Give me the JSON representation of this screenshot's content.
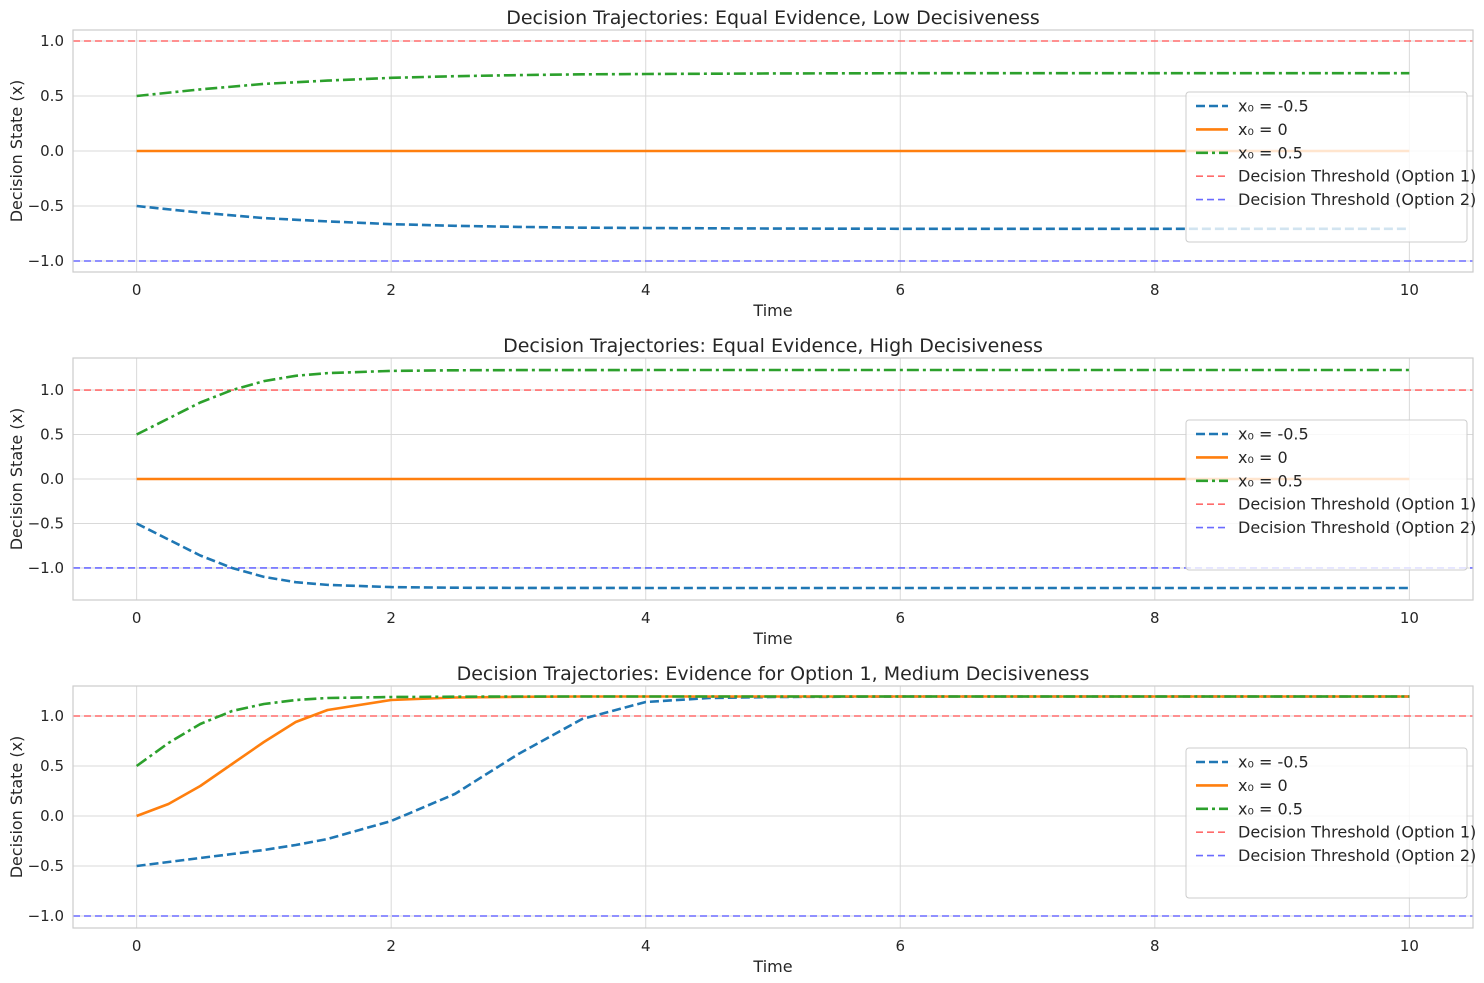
{
  "colors": {
    "series": [
      "#1f77b4",
      "#ff7f0e",
      "#2ca02c"
    ],
    "threshold_option1": "#ff6b6b",
    "threshold_option2": "#6b6bff",
    "grid": "#d9d9d9"
  },
  "chart_data": [
    {
      "type": "line",
      "title": "Decision Trajectories: Equal Evidence, Low Decisiveness",
      "xlabel": "Time",
      "ylabel": "Decision State (x)",
      "xlim": [
        -0.5,
        10.5
      ],
      "ylim": [
        -1.1,
        1.1
      ],
      "xticks": [
        0,
        2,
        4,
        6,
        8,
        10
      ],
      "yticks": [
        -1.0,
        -0.5,
        0.0,
        0.5,
        1.0
      ],
      "grid": true,
      "legend_position": "center-right",
      "x": [
        0,
        0.5,
        1,
        1.5,
        2,
        2.5,
        3,
        3.5,
        4,
        5,
        6,
        7,
        8,
        9,
        10
      ],
      "series": [
        {
          "name": "x₀ = -0.5",
          "style": "dashed",
          "values": [
            -0.5,
            -0.56,
            -0.61,
            -0.64,
            -0.665,
            -0.68,
            -0.69,
            -0.697,
            -0.7,
            -0.705,
            -0.707,
            -0.707,
            -0.707,
            -0.707,
            -0.707
          ]
        },
        {
          "name": "x₀ = 0",
          "style": "solid",
          "values": [
            0,
            0,
            0,
            0,
            0,
            0,
            0,
            0,
            0,
            0,
            0,
            0,
            0,
            0,
            0
          ]
        },
        {
          "name": "x₀ = 0.5",
          "style": "dashdot",
          "values": [
            0.5,
            0.56,
            0.61,
            0.64,
            0.665,
            0.68,
            0.69,
            0.697,
            0.7,
            0.705,
            0.707,
            0.707,
            0.707,
            0.707,
            0.707
          ]
        }
      ],
      "thresholds": [
        {
          "name": "Decision Threshold (Option 1)",
          "value": 1.0
        },
        {
          "name": "Decision Threshold (Option 2)",
          "value": -1.0
        }
      ]
    },
    {
      "type": "line",
      "title": "Decision Trajectories: Equal Evidence, High Decisiveness",
      "xlabel": "Time",
      "ylabel": "Decision State (x)",
      "xlim": [
        -0.5,
        10.5
      ],
      "ylim": [
        -1.36,
        1.36
      ],
      "xticks": [
        0,
        2,
        4,
        6,
        8,
        10
      ],
      "yticks": [
        -1.0,
        -0.5,
        0.0,
        0.5,
        1.0
      ],
      "grid": true,
      "legend_position": "center-right",
      "x": [
        0,
        0.25,
        0.5,
        0.75,
        1,
        1.25,
        1.5,
        2,
        2.5,
        3,
        4,
        5,
        6,
        7,
        8,
        9,
        10
      ],
      "series": [
        {
          "name": "x₀ = -0.5",
          "style": "dashed",
          "values": [
            -0.5,
            -0.68,
            -0.86,
            -1.0,
            -1.1,
            -1.16,
            -1.19,
            -1.215,
            -1.222,
            -1.224,
            -1.225,
            -1.225,
            -1.225,
            -1.225,
            -1.225,
            -1.225,
            -1.225
          ]
        },
        {
          "name": "x₀ = 0",
          "style": "solid",
          "values": [
            0,
            0,
            0,
            0,
            0,
            0,
            0,
            0,
            0,
            0,
            0,
            0,
            0,
            0,
            0,
            0,
            0
          ]
        },
        {
          "name": "x₀ = 0.5",
          "style": "dashdot",
          "values": [
            0.5,
            0.68,
            0.86,
            1.0,
            1.1,
            1.16,
            1.19,
            1.215,
            1.222,
            1.224,
            1.225,
            1.225,
            1.225,
            1.225,
            1.225,
            1.225,
            1.225
          ]
        }
      ],
      "thresholds": [
        {
          "name": "Decision Threshold (Option 1)",
          "value": 1.0
        },
        {
          "name": "Decision Threshold (Option 2)",
          "value": -1.0
        }
      ]
    },
    {
      "type": "line",
      "title": "Decision Trajectories: Evidence for Option 1, Medium Decisiveness",
      "xlabel": "Time",
      "ylabel": "Decision State (x)",
      "xlim": [
        -0.5,
        10.5
      ],
      "ylim": [
        -1.12,
        1.3
      ],
      "xticks": [
        0,
        2,
        4,
        6,
        8,
        10
      ],
      "yticks": [
        -1.0,
        -0.5,
        0.0,
        0.5,
        1.0
      ],
      "grid": true,
      "legend_position": "center-right",
      "x": [
        0,
        0.25,
        0.5,
        0.75,
        1,
        1.25,
        1.5,
        2,
        2.5,
        3,
        3.5,
        4,
        4.5,
        5,
        6,
        7,
        8,
        9,
        10
      ],
      "series": [
        {
          "name": "x₀ = -0.5",
          "style": "dashed",
          "values": [
            -0.5,
            -0.46,
            -0.42,
            -0.38,
            -0.34,
            -0.29,
            -0.23,
            -0.05,
            0.22,
            0.62,
            0.97,
            1.14,
            1.18,
            1.19,
            1.195,
            1.195,
            1.195,
            1.195,
            1.195
          ]
        },
        {
          "name": "x₀ = 0",
          "style": "solid",
          "values": [
            0,
            0.12,
            0.3,
            0.52,
            0.74,
            0.94,
            1.06,
            1.16,
            1.185,
            1.192,
            1.195,
            1.195,
            1.195,
            1.195,
            1.195,
            1.195,
            1.195,
            1.195,
            1.195
          ]
        },
        {
          "name": "x₀ = 0.5",
          "style": "dashdot",
          "values": [
            0.5,
            0.73,
            0.92,
            1.05,
            1.12,
            1.16,
            1.18,
            1.19,
            1.193,
            1.195,
            1.195,
            1.195,
            1.195,
            1.195,
            1.195,
            1.195,
            1.195,
            1.195,
            1.195
          ]
        }
      ],
      "thresholds": [
        {
          "name": "Decision Threshold (Option 1)",
          "value": 1.0
        },
        {
          "name": "Decision Threshold (Option 2)",
          "value": -1.0
        }
      ]
    }
  ]
}
